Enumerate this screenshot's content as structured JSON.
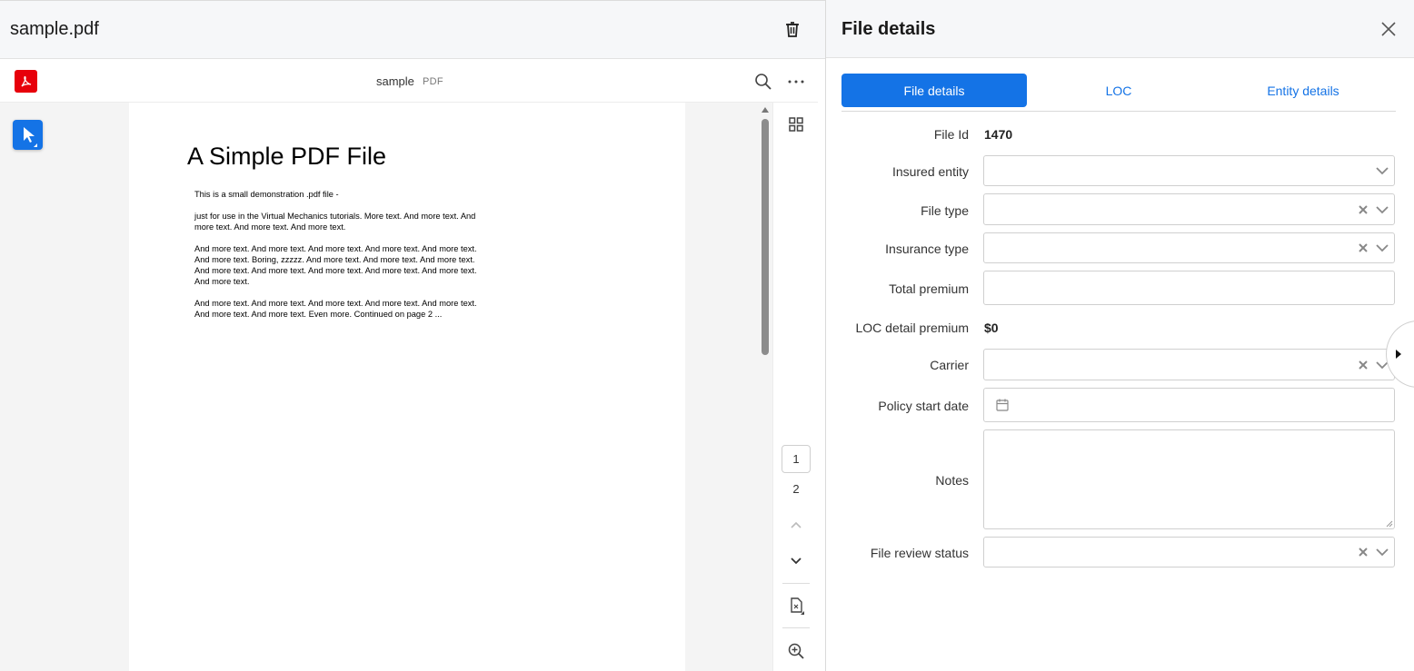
{
  "left": {
    "file_title": "sample.pdf",
    "viewer": {
      "doc_name": "sample",
      "doc_ext": "PDF",
      "pages": [
        "1",
        "2"
      ]
    },
    "pdf": {
      "heading": "A Simple PDF File",
      "paragraphs": [
        "This is a small demonstration .pdf file -",
        "just for use in the Virtual Mechanics tutorials. More text. And more text. And more text. And more text. And more text.",
        "And more text. And more text. And more text. And more text. And more text. And more text. Boring, zzzzz. And more text. And more text. And more text. And more text. And more text. And more text. And more text. And more text. And more text.",
        "And more text. And more text. And more text. And more text. And more text. And more text. And more text. Even more. Continued on page 2 ..."
      ]
    }
  },
  "right": {
    "title": "File details",
    "tabs": [
      {
        "label": "File details",
        "active": true
      },
      {
        "label": "LOC",
        "active": false
      },
      {
        "label": "Entity details",
        "active": false
      }
    ],
    "form": {
      "file_id_label": "File Id",
      "file_id_value": "1470",
      "insured_entity_label": "Insured entity",
      "file_type_label": "File type",
      "insurance_type_label": "Insurance type",
      "total_premium_label": "Total premium",
      "loc_detail_premium_label": "LOC detail premium",
      "loc_detail_premium_value": "$0",
      "carrier_label": "Carrier",
      "policy_start_date_label": "Policy start date",
      "notes_label": "Notes",
      "file_review_status_label": "File review status"
    }
  },
  "colors": {
    "accent": "#1473e6",
    "acrobat_red": "#e7000b"
  }
}
